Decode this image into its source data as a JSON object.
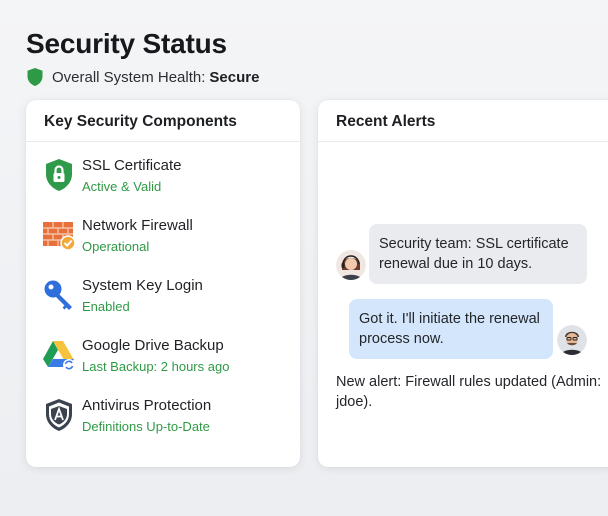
{
  "header": {
    "title": "Security Status",
    "health_label": "Overall System Health:",
    "health_value": "Secure"
  },
  "components": {
    "title": "Key Security Components",
    "items": [
      {
        "name": "SSL Certificate",
        "status": "Active & Valid",
        "icon": "lock-shield-icon"
      },
      {
        "name": "Network Firewall",
        "status": "Operational",
        "icon": "firewall-icon"
      },
      {
        "name": "System Key Login",
        "status": "Enabled",
        "icon": "key-icon"
      },
      {
        "name": "Google Drive Backup",
        "status": "Last Backup: 2 hours ago",
        "icon": "google-drive-icon"
      },
      {
        "name": "Antivirus Protection",
        "status": "Definitions Up-to-Date",
        "icon": "antivirus-shield-icon"
      }
    ]
  },
  "alerts": {
    "title": "Recent Alerts",
    "messages": [
      {
        "text": "Security team: SSL certificate renewal due in 10 days.",
        "direction": "incoming"
      },
      {
        "text": "Got it. I'll initiate the renewal process now.",
        "direction": "outgoing"
      }
    ],
    "system_alert": "New alert: Firewall rules updated (Admin: jdoe)."
  },
  "colors": {
    "status_green": "#2f9a45",
    "incoming_bubble": "#e9ebee",
    "outgoing_bubble": "#d3e6fb"
  }
}
